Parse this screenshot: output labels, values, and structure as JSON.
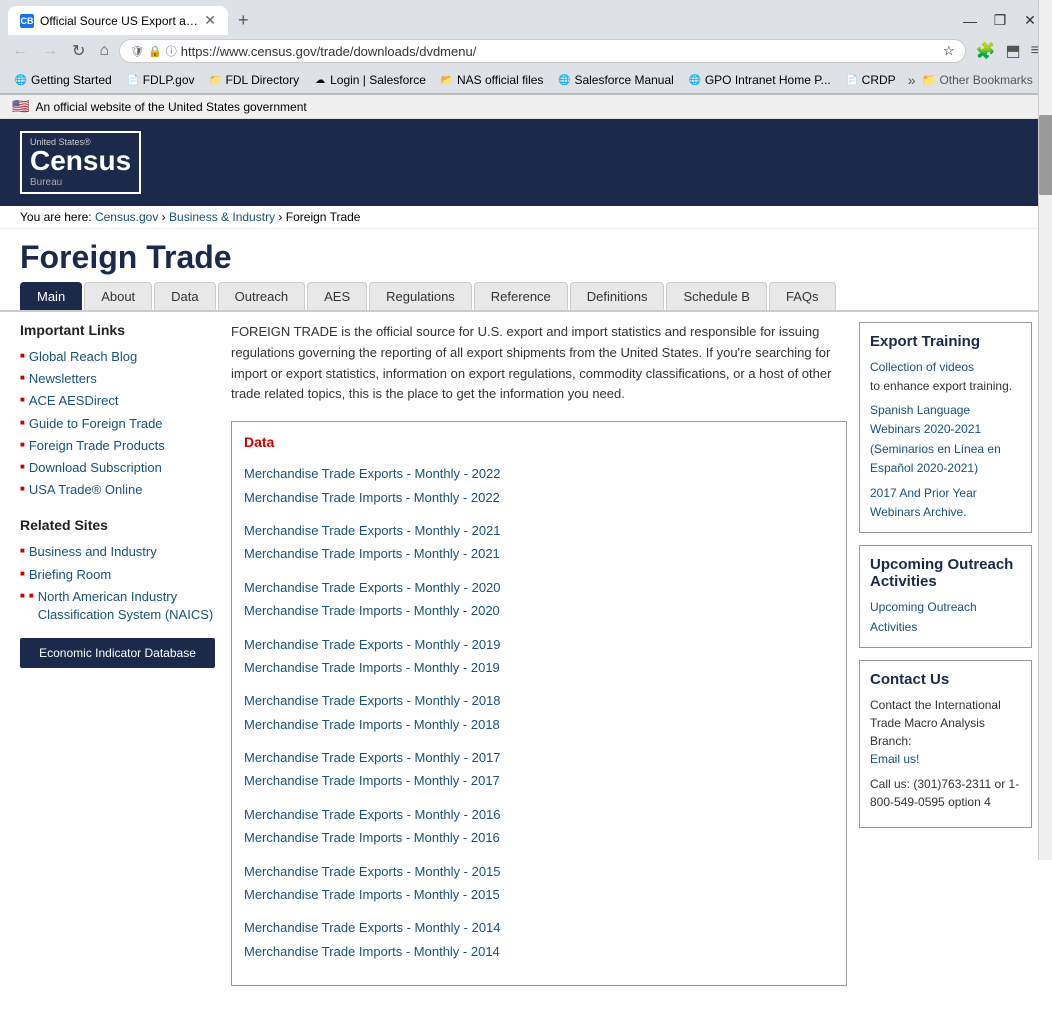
{
  "browser": {
    "tab_title": "Official Source US Export and I",
    "tab_favicon": "CB",
    "url": "https://www.census.gov/trade/downloads/dvdmenu/",
    "new_tab_label": "+",
    "window_controls": [
      "—",
      "❒",
      "✕"
    ],
    "nav_back": "←",
    "nav_forward": "→",
    "nav_reload": "↻",
    "nav_home": "⌂"
  },
  "bookmarks": [
    {
      "label": "Getting Started",
      "icon": "🌐"
    },
    {
      "label": "FDLP.gov",
      "icon": "📄"
    },
    {
      "label": "FDL Directory",
      "icon": "📁"
    },
    {
      "label": "Login | Salesforce",
      "icon": "☁"
    },
    {
      "label": "NAS official files",
      "icon": "📂"
    },
    {
      "label": "Salesforce Manual",
      "icon": "🌐"
    },
    {
      "label": "GPO Intranet Home P...",
      "icon": "🌐"
    },
    {
      "label": "CRDP",
      "icon": "📄"
    }
  ],
  "bookmarks_overflow": "»",
  "bookmarks_other": "Other Bookmarks",
  "gov_banner": "An official website of the United States government",
  "site": {
    "logo_top": "United States®",
    "logo_main": "Census",
    "logo_bureau": "Bureau"
  },
  "breadcrumb": {
    "home": "Census.gov",
    "section": "Business & Industry",
    "current": "Foreign Trade"
  },
  "page_title": "Foreign Trade",
  "nav_tabs": [
    "Main",
    "About",
    "Data",
    "Outreach",
    "AES",
    "Regulations",
    "Reference",
    "Definitions",
    "Schedule B",
    "FAQs"
  ],
  "active_tab": "Main",
  "intro_text": "FOREIGN TRADE is the official source for U.S. export and import statistics and responsible for issuing regulations governing the reporting of all export shipments from the United States. If you're searching for import or export statistics, information on export regulations, commodity classifications, or a host of other trade related topics, this is the place to get the information you need.",
  "sidebar": {
    "important_links_title": "Important Links",
    "links": [
      "Global Reach Blog",
      "Newsletters",
      "ACE AESDirect",
      "Guide to Foreign Trade",
      "Foreign Trade Products",
      "Download Subscription",
      "USA Trade® Online"
    ],
    "related_sites_title": "Related Sites",
    "related_links": [
      {
        "label": "Business and Industry",
        "bullet": true,
        "indent": false
      },
      {
        "label": "Briefing Room",
        "bullet": true,
        "indent": false
      },
      {
        "label": "North American Industry Classification System (NAICS)",
        "bullet": true,
        "indent": true
      }
    ],
    "db_button": "Economic Indicator Database"
  },
  "data_section": {
    "title": "Data",
    "links": [
      {
        "text": "Merchandise Trade Exports - Monthly - 2022",
        "href": "#"
      },
      {
        "text": "Merchandise Trade Imports - Monthly - 2022",
        "href": "#"
      },
      {
        "text": "Merchandise Trade Exports - Monthly - 2021",
        "href": "#"
      },
      {
        "text": "Merchandise Trade Imports - Monthly - 2021",
        "href": "#"
      },
      {
        "text": "Merchandise Trade Exports - Monthly - 2020",
        "href": "#"
      },
      {
        "text": "Merchandise Trade Imports - Monthly - 2020",
        "href": "#"
      },
      {
        "text": "Merchandise Trade Exports - Monthly - 2019",
        "href": "#"
      },
      {
        "text": "Merchandise Trade Imports - Monthly - 2019",
        "href": "#"
      },
      {
        "text": "Merchandise Trade Exports - Monthly - 2018",
        "href": "#"
      },
      {
        "text": "Merchandise Trade Imports - Monthly - 2018",
        "href": "#"
      },
      {
        "text": "Merchandise Trade Exports - Monthly - 2017",
        "href": "#"
      },
      {
        "text": "Merchandise Trade Imports - Monthly - 2017",
        "href": "#"
      },
      {
        "text": "Merchandise Trade Exports - Monthly - 2016",
        "href": "#"
      },
      {
        "text": "Merchandise Trade Imports - Monthly - 2016",
        "href": "#"
      },
      {
        "text": "Merchandise Trade Exports - Monthly - 2015",
        "href": "#"
      },
      {
        "text": "Merchandise Trade Imports - Monthly - 2015",
        "href": "#"
      },
      {
        "text": "Merchandise Trade Exports - Monthly - 2014",
        "href": "#"
      },
      {
        "text": "Merchandise Trade Imports - Monthly - 2014",
        "href": "#"
      }
    ]
  },
  "right_sidebar": {
    "export_training": {
      "title": "Export Training",
      "collection_link": "Collection of videos",
      "collection_suffix": " to enhance export training.",
      "spanish_link": "Spanish Language Webinars 2020-2021 (Seminarios en Línea en Español 2020-2021)",
      "archive_link": "2017 And Prior Year Webinars Archive."
    },
    "outreach": {
      "title": "Upcoming Outreach Activities",
      "link": "Upcoming Outreach Activities"
    },
    "contact": {
      "title": "Contact Us",
      "body": "Contact the International Trade Macro Analysis Branch:",
      "email_link": "Email us!",
      "phone": "Call us: (301)763-2311 or 1-800-549-0595 option 4"
    }
  }
}
